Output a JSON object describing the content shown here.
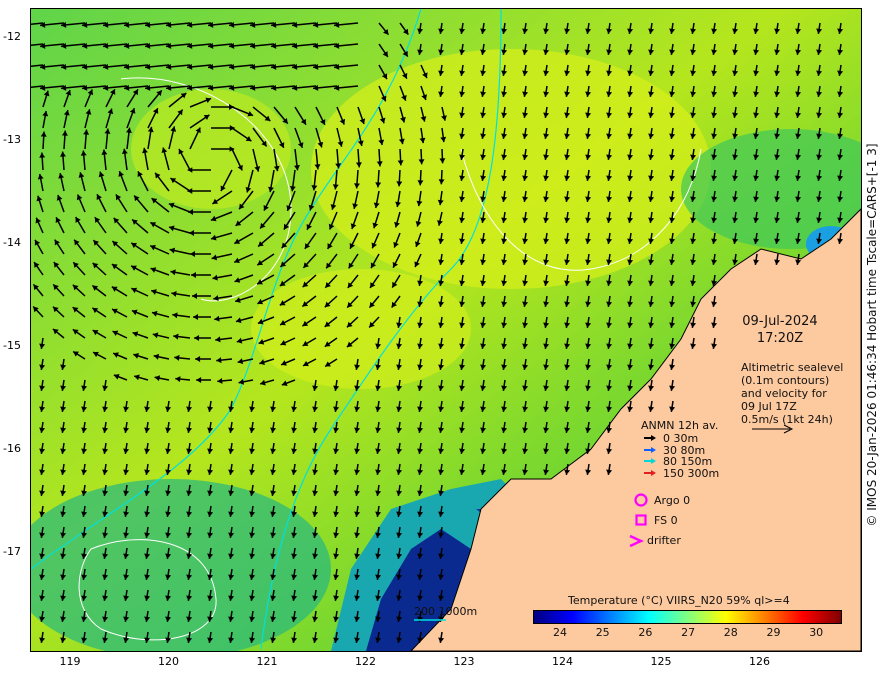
{
  "map": {
    "date_line1": "09-Jul-2024",
    "date_line2": "17:20Z",
    "note_lines": [
      "Altimetric sealevel",
      "(0.1m contours)",
      "and velocity for",
      "09 Jul 17Z",
      "0.5m/s (1kt 24h)"
    ],
    "lat_ticks": [
      "-12",
      "-13",
      "-14",
      "-15",
      "-16",
      "-17"
    ],
    "lon_ticks": [
      "119",
      "120",
      "121",
      "122",
      "123",
      "124",
      "125",
      "126"
    ],
    "anmn_title": "ANMN 12h av.",
    "anmn_items": [
      {
        "label": "0 30m",
        "color": "#000000"
      },
      {
        "label": "30 80m",
        "color": "#1060ff"
      },
      {
        "label": "80 150m",
        "color": "#00d8d8"
      },
      {
        "label": "150 300m",
        "color": "#e02020"
      }
    ],
    "argo_label": "Argo 0",
    "fs_label": "FS 0",
    "drifter_label": "drifter",
    "marker_color": "#ff00ff",
    "depth_label": "200  1000m",
    "colorbar_title": "Temperature (°C) VIIRS_N20 59% ql>=4",
    "colorbar_ticks": [
      "24",
      "25",
      "26",
      "27",
      "28",
      "29",
      "30"
    ],
    "colorbar_colors": [
      "#000080",
      "#0000ff",
      "#0080ff",
      "#00ffff",
      "#80ff80",
      "#ffff00",
      "#ff8000",
      "#ff0000",
      "#800000"
    ],
    "land_color": "#fdc99e",
    "copyright": "© IMOS 20-Jan-2026 01:46:34 Hobart time Tscale=CARS+[-1 3]"
  }
}
